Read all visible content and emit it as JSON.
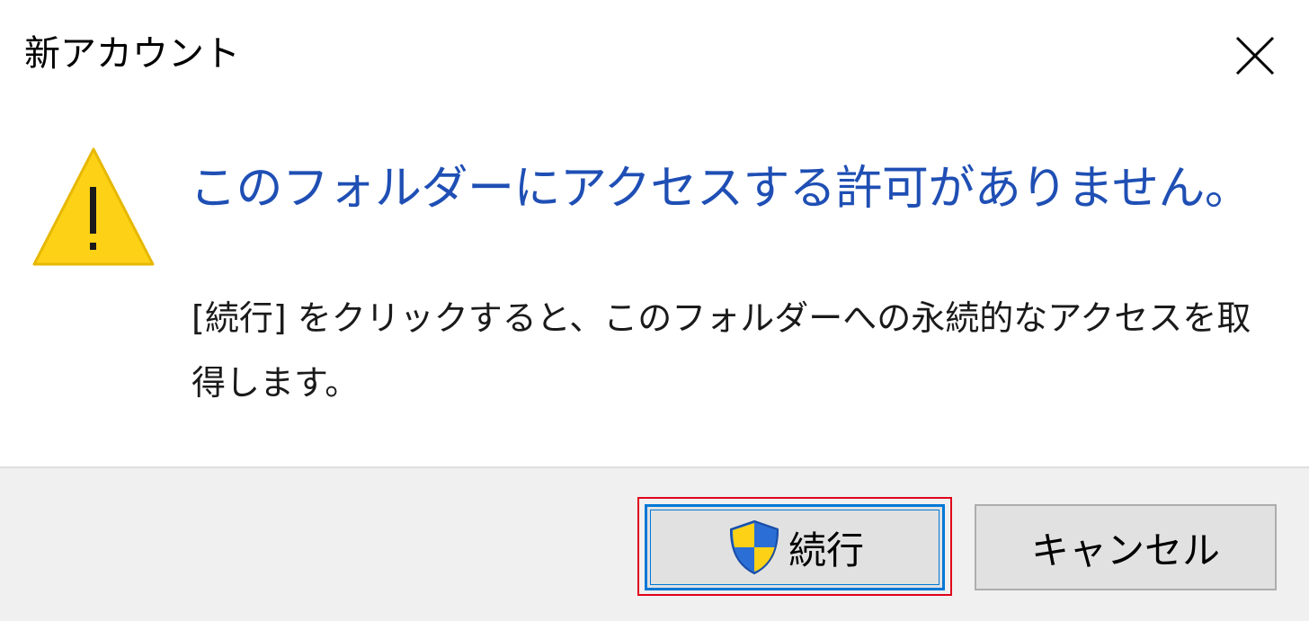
{
  "window": {
    "title": "新アカウント",
    "close_icon": "close-icon"
  },
  "message": {
    "icon": "warning-icon",
    "heading": "このフォルダーにアクセスする許可がありません。",
    "description": "[続行] をクリックすると、このフォルダーへの永続的なアクセスを取得します。"
  },
  "buttons": {
    "continue_label": "続行",
    "continue_icon": "uac-shield-icon",
    "cancel_label": "キャンセル"
  },
  "colors": {
    "heading": "#1f4fb4",
    "warning_fill": "#fcd116",
    "focus_border": "#0078d7",
    "highlight_box": "#e0001a",
    "footer_bg": "#f0f0f0"
  }
}
